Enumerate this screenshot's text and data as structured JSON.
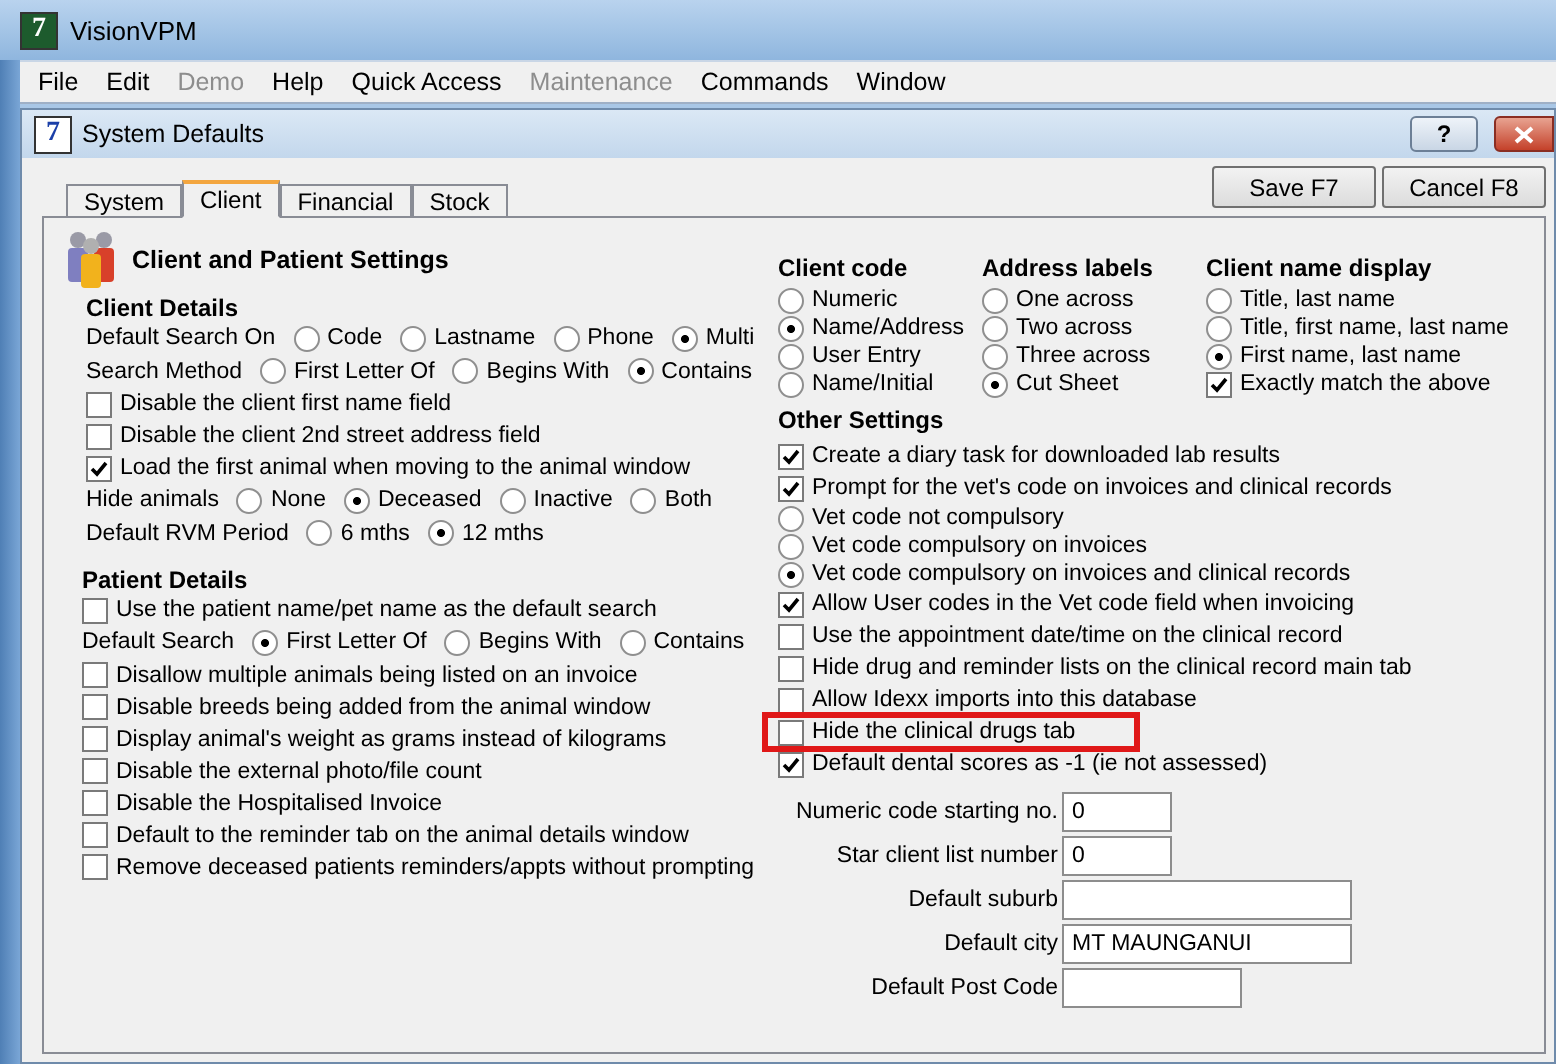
{
  "app_window": {
    "logo": "7",
    "title": "VisionVPM"
  },
  "menu": [
    {
      "label": "File",
      "disabled": false
    },
    {
      "label": "Edit",
      "disabled": false
    },
    {
      "label": "Demo",
      "disabled": true
    },
    {
      "label": "Help",
      "disabled": false
    },
    {
      "label": "Quick Access",
      "disabled": false
    },
    {
      "label": "Maintenance",
      "disabled": true
    },
    {
      "label": "Commands",
      "disabled": false
    },
    {
      "label": "Window",
      "disabled": false
    }
  ],
  "dialog": {
    "logo": "7",
    "title": "System Defaults",
    "help": "?"
  },
  "tabs": [
    {
      "label": "System",
      "selected": false
    },
    {
      "label": "Client",
      "selected": true
    },
    {
      "label": "Financial",
      "selected": false
    },
    {
      "label": "Stock",
      "selected": false
    }
  ],
  "buttons": [
    "Save F7",
    "Cancel F8"
  ],
  "left": {
    "title": "Client and Patient Settings",
    "sections": [
      {
        "heading": "Client Details",
        "rows": [
          {
            "kind": "radio_group",
            "label": "Default Search On",
            "options": [
              {
                "label": "Code",
                "selected": false
              },
              {
                "label": "Lastname",
                "selected": false
              },
              {
                "label": "Phone",
                "selected": false
              },
              {
                "label": "Multi",
                "selected": true
              }
            ]
          },
          {
            "kind": "radio_group",
            "label": "Search Method",
            "options": [
              {
                "label": "First Letter Of",
                "selected": false
              },
              {
                "label": "Begins With",
                "selected": false
              },
              {
                "label": "Contains",
                "selected": true
              }
            ]
          },
          {
            "kind": "checkbox",
            "label": "Disable the client first name field",
            "checked": false
          },
          {
            "kind": "checkbox",
            "label": "Disable the client 2nd street address field",
            "checked": false
          },
          {
            "kind": "checkbox",
            "label": "Load the first animal when moving to the animal window",
            "checked": true
          },
          {
            "kind": "radio_group",
            "label": "Hide animals",
            "options": [
              {
                "label": "None",
                "selected": false
              },
              {
                "label": "Deceased",
                "selected": true
              },
              {
                "label": "Inactive",
                "selected": false
              },
              {
                "label": "Both",
                "selected": false
              }
            ]
          },
          {
            "kind": "radio_group",
            "label": "Default RVM Period",
            "options": [
              {
                "label": "6 mths",
                "selected": false
              },
              {
                "label": "12 mths",
                "selected": true
              }
            ]
          }
        ]
      },
      {
        "heading": "Patient Details",
        "rows": [
          {
            "kind": "checkbox",
            "label": "Use the patient name/pet name as the default search",
            "checked": false
          },
          {
            "kind": "radio_group",
            "label": "Default Search",
            "options": [
              {
                "label": "First Letter Of",
                "selected": true
              },
              {
                "label": "Begins With",
                "selected": false
              },
              {
                "label": "Contains",
                "selected": false
              }
            ]
          },
          {
            "kind": "checkbox",
            "label": "Disallow multiple animals being listed on an invoice",
            "checked": false
          },
          {
            "kind": "checkbox",
            "label": "Disable breeds being added from the animal window",
            "checked": false
          },
          {
            "kind": "checkbox",
            "label": "Display animal's weight as grams instead of kilograms",
            "checked": false
          },
          {
            "kind": "checkbox",
            "label": "Disable the external photo/file count",
            "checked": false
          },
          {
            "kind": "checkbox",
            "label": "Disable the Hospitalised Invoice",
            "checked": false
          },
          {
            "kind": "checkbox",
            "label": "Default to the reminder tab on the animal details window",
            "checked": false
          },
          {
            "kind": "checkbox",
            "label": "Remove deceased patients reminders/appts without prompting",
            "checked": false
          }
        ]
      }
    ]
  },
  "right": {
    "groups": [
      {
        "heading": "Client code",
        "rows": [
          {
            "kind": "radio",
            "label": "Numeric",
            "selected": false
          },
          {
            "kind": "radio",
            "label": "Name/Address",
            "selected": true
          },
          {
            "kind": "radio",
            "label": "User Entry",
            "selected": false
          },
          {
            "kind": "radio",
            "label": "Name/Initial",
            "selected": false
          }
        ]
      },
      {
        "heading": "Address labels",
        "rows": [
          {
            "kind": "radio",
            "label": "One across",
            "selected": false
          },
          {
            "kind": "radio",
            "label": "Two across",
            "selected": false
          },
          {
            "kind": "radio",
            "label": "Three across",
            "selected": false
          },
          {
            "kind": "radio",
            "label": "Cut Sheet",
            "selected": true
          }
        ]
      },
      {
        "heading": "Client name display",
        "rows": [
          {
            "kind": "radio",
            "label": "Title, last name",
            "selected": false
          },
          {
            "kind": "radio",
            "label": "Title, first name, last name",
            "selected": false
          },
          {
            "kind": "radio",
            "label": "First name, last name",
            "selected": true
          },
          {
            "kind": "checkbox",
            "label": "Exactly match the above",
            "checked": true
          }
        ]
      }
    ],
    "other": {
      "heading": "Other Settings",
      "rows": [
        {
          "kind": "checkbox",
          "label": "Create a diary task for downloaded lab results",
          "checked": true,
          "highlighted": false
        },
        {
          "kind": "checkbox",
          "label": "Prompt for the vet's code on invoices and clinical records",
          "checked": true,
          "highlighted": false
        },
        {
          "kind": "radio",
          "label": "Vet code not compulsory",
          "selected": false,
          "highlighted": false
        },
        {
          "kind": "radio",
          "label": "Vet code compulsory on invoices",
          "selected": false,
          "highlighted": false
        },
        {
          "kind": "radio",
          "label": "Vet code compulsory on invoices and clinical records",
          "selected": true,
          "highlighted": false
        },
        {
          "kind": "checkbox",
          "label": "Allow User codes in the Vet code field when invoicing",
          "checked": true,
          "highlighted": false
        },
        {
          "kind": "checkbox",
          "label": "Use the appointment date/time on the clinical record",
          "checked": false,
          "highlighted": false
        },
        {
          "kind": "checkbox",
          "label": "Hide drug and reminder lists on the clinical record main tab",
          "checked": false,
          "highlighted": false
        },
        {
          "kind": "checkbox",
          "label": "Allow Idexx imports into this database",
          "checked": false,
          "highlighted": false
        },
        {
          "kind": "checkbox",
          "label": "Hide the clinical drugs tab",
          "checked": false,
          "highlighted": true
        },
        {
          "kind": "checkbox",
          "label": "Default dental scores as -1 (ie not assessed)",
          "checked": true,
          "highlighted": false
        }
      ]
    },
    "fields": [
      {
        "label": "Numeric code starting no.",
        "value": "0"
      },
      {
        "label": "Star client list number",
        "value": "0"
      },
      {
        "label": "Default suburb"
      },
      {
        "label": "Default city",
        "value": "MT MAUNGANUI"
      },
      {
        "label": "Default Post Code"
      }
    ]
  }
}
